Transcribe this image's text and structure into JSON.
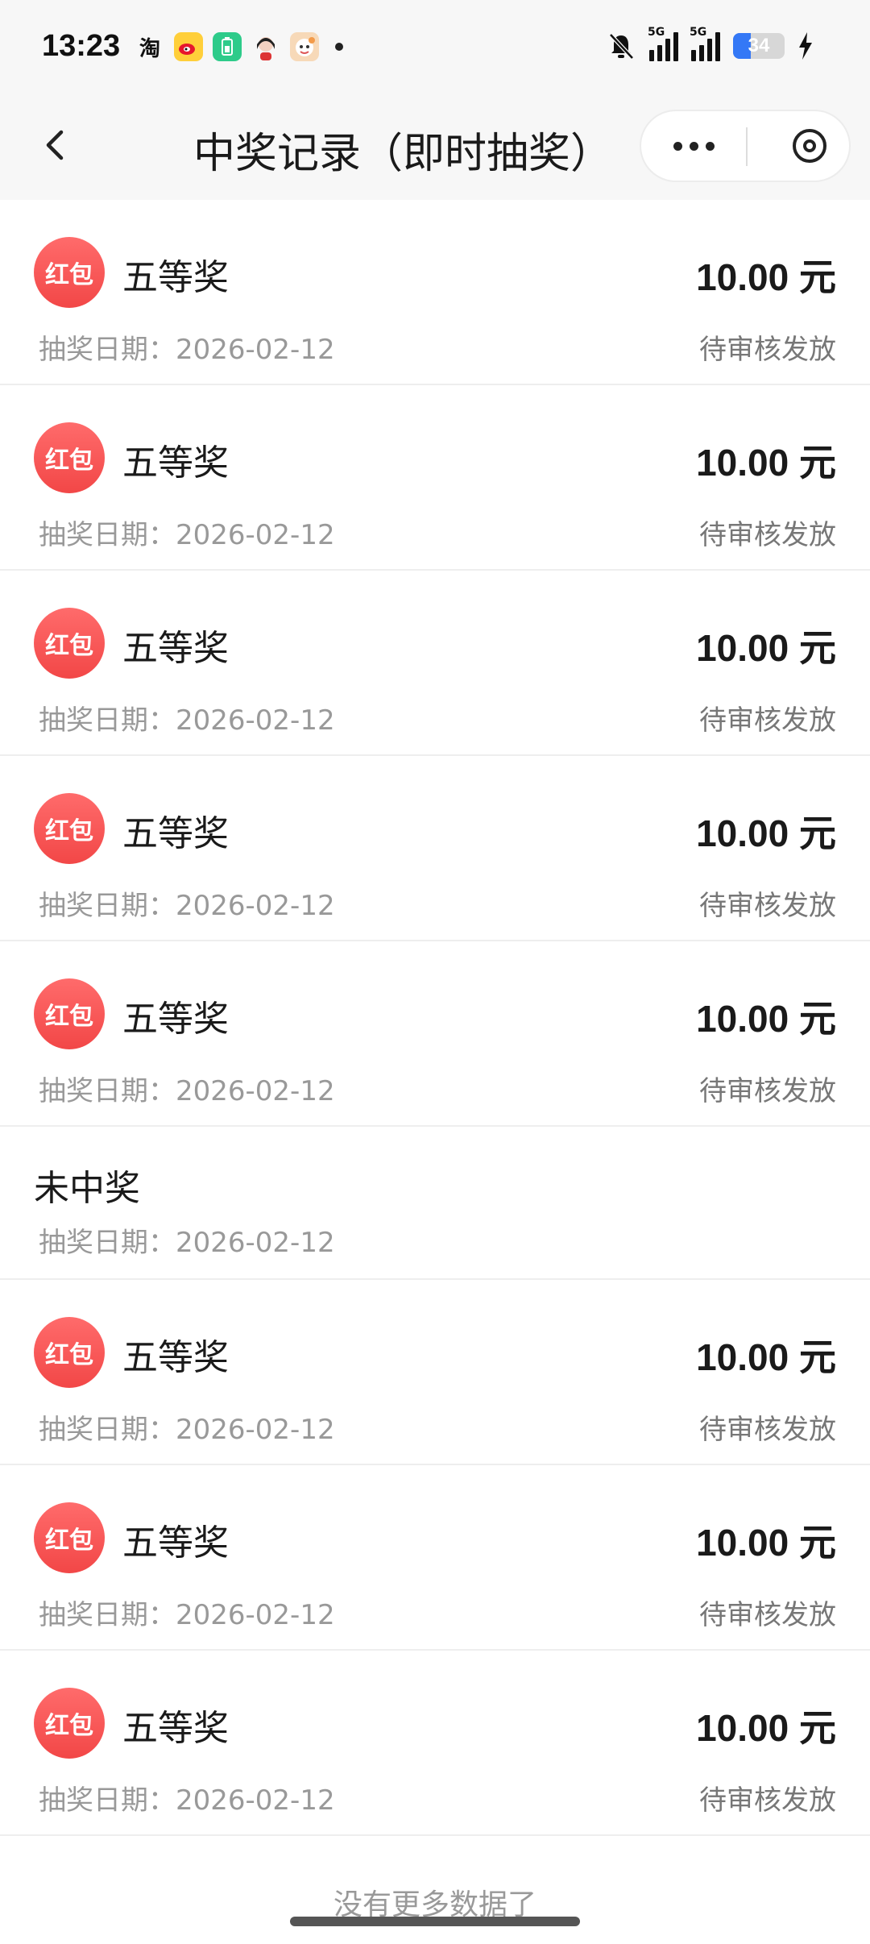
{
  "status_bar": {
    "time": "13:23",
    "app_icons": [
      "taobao-icon",
      "weibo-icon",
      "battery-app-icon",
      "avatar-app-icon",
      "game-app-icon"
    ],
    "taobao_label": "淘",
    "network": [
      "5G",
      "5G"
    ],
    "battery_percent": "34",
    "battery_level": 0.34
  },
  "nav": {
    "title": "中奖记录（即时抽奖）"
  },
  "records": [
    {
      "badge": "红包",
      "prize": "五等奖",
      "amount": "10.00 元",
      "date": "抽奖日期：2026-02-12",
      "status": "待审核发放"
    },
    {
      "badge": "红包",
      "prize": "五等奖",
      "amount": "10.00 元",
      "date": "抽奖日期：2026-02-12",
      "status": "待审核发放"
    },
    {
      "badge": "红包",
      "prize": "五等奖",
      "amount": "10.00 元",
      "date": "抽奖日期：2026-02-12",
      "status": "待审核发放"
    },
    {
      "badge": "红包",
      "prize": "五等奖",
      "amount": "10.00 元",
      "date": "抽奖日期：2026-02-12",
      "status": "待审核发放"
    },
    {
      "badge": "红包",
      "prize": "五等奖",
      "amount": "10.00 元",
      "date": "抽奖日期：2026-02-12",
      "status": "待审核发放"
    },
    {
      "prize": "未中奖",
      "date": "抽奖日期：2026-02-12"
    },
    {
      "badge": "红包",
      "prize": "五等奖",
      "amount": "10.00 元",
      "date": "抽奖日期：2026-02-12",
      "status": "待审核发放"
    },
    {
      "badge": "红包",
      "prize": "五等奖",
      "amount": "10.00 元",
      "date": "抽奖日期：2026-02-12",
      "status": "待审核发放"
    },
    {
      "badge": "红包",
      "prize": "五等奖",
      "amount": "10.00 元",
      "date": "抽奖日期：2026-02-12",
      "status": "待审核发放"
    }
  ],
  "footer": "没有更多数据了",
  "colors": {
    "badge": "#f24747",
    "accent": "#3478f6"
  }
}
